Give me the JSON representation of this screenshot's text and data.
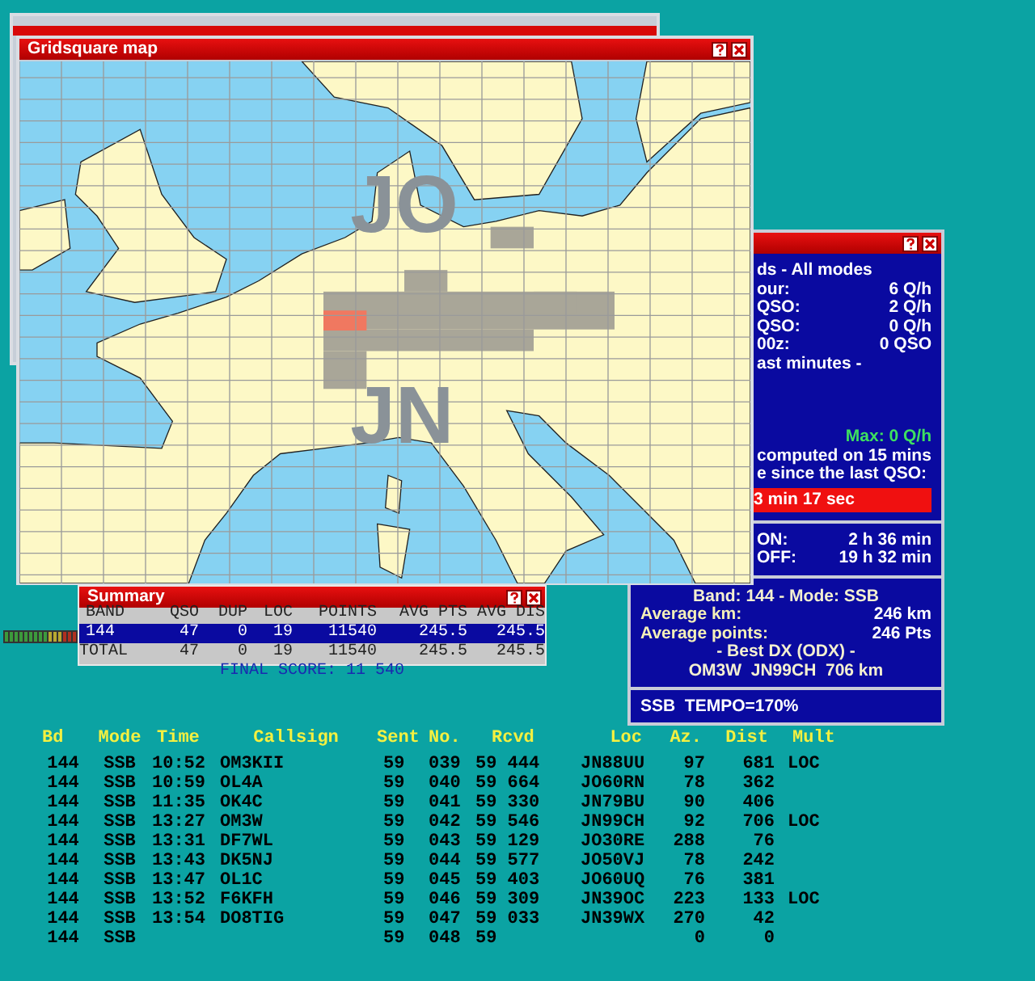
{
  "map_window": {
    "title": "Gridsquare map",
    "grid_labels": [
      "JO",
      "JN"
    ]
  },
  "rate_window": {
    "sections": [
      {
        "rows": [
          {
            "kind": "text",
            "text": "ds - All modes"
          },
          {
            "kind": "pair",
            "label": "our:",
            "value": "6 Q/h"
          },
          {
            "kind": "pair",
            "label": "QSO:",
            "value": "2 Q/h"
          },
          {
            "kind": "pair",
            "label": "QSO:",
            "value": "0 Q/h"
          },
          {
            "kind": "pair",
            "label": "00z:",
            "value": "0 QSO"
          },
          {
            "kind": "text",
            "text": "ast minutes -"
          },
          {
            "kind": "highlight",
            "text": "Max: 0 Q/h"
          },
          {
            "kind": "text",
            "text": "computed on 15 mins"
          },
          {
            "kind": "text",
            "text": "e since the last QSO:"
          },
          {
            "kind": "alert",
            "text": "3 min 17 sec"
          }
        ]
      },
      {
        "rows": [
          {
            "kind": "pair",
            "label": "ON:",
            "value": "2 h 36 min"
          },
          {
            "kind": "pair",
            "label": "OFF:",
            "value": "19 h 32 min"
          }
        ]
      },
      {
        "rows": [
          {
            "kind": "center",
            "text": "Band: 144 - Mode: SSB"
          },
          {
            "kind": "pair",
            "label": "Average km:",
            "value": "246 km"
          },
          {
            "kind": "pair",
            "label": "Average points:",
            "value": "246 Pts"
          },
          {
            "kind": "center",
            "text": "- Best DX (ODX) -"
          },
          {
            "kind": "center",
            "text": "OM3W  JN99CH  706 km"
          }
        ]
      },
      {
        "rows": [
          {
            "kind": "text",
            "text": "SSB  TEMPO=170%"
          }
        ]
      }
    ]
  },
  "summary": {
    "title": "Summary",
    "columns": [
      "BAND",
      "QSO",
      "DUP",
      "LOC",
      "POINTS",
      "AVG PTS",
      "AVG DIS"
    ],
    "rows": [
      {
        "cells": [
          "144",
          "47",
          "0",
          "19",
          "11540",
          "245.5",
          "245.5"
        ],
        "selected": true
      },
      {
        "cells": [
          "TOTAL",
          "47",
          "0",
          "19",
          "11540",
          "245.5",
          "245.5"
        ],
        "selected": false
      }
    ],
    "final_score": "FINAL SCORE: 11 540"
  },
  "log": {
    "columns": [
      "Bd",
      "Mode",
      "Time",
      "Callsign",
      "Sent",
      "No.",
      "Rcvd",
      "Loc",
      "Az.",
      "Dist",
      "Mult"
    ],
    "rows": [
      {
        "bd": "144",
        "mode": "SSB",
        "time": "10:52",
        "callsign": "OM3KII",
        "sent": "59",
        "no": "039",
        "rcvd": "59 444",
        "loc": "JN88UU",
        "az": "97",
        "dist": "681",
        "mult": "LOC"
      },
      {
        "bd": "144",
        "mode": "SSB",
        "time": "10:59",
        "callsign": "OL4A",
        "sent": "59",
        "no": "040",
        "rcvd": "59 664",
        "loc": "JO60RN",
        "az": "78",
        "dist": "362"
      },
      {
        "bd": "144",
        "mode": "SSB",
        "time": "11:35",
        "callsign": "OK4C",
        "sent": "59",
        "no": "041",
        "rcvd": "59 330",
        "loc": "JN79BU",
        "az": "90",
        "dist": "406"
      },
      {
        "bd": "144",
        "mode": "SSB",
        "time": "13:27",
        "callsign": "OM3W",
        "sent": "59",
        "no": "042",
        "rcvd": "59 546",
        "loc": "JN99CH",
        "az": "92",
        "dist": "706",
        "mult": "LOC"
      },
      {
        "bd": "144",
        "mode": "SSB",
        "time": "13:31",
        "callsign": "DF7WL",
        "sent": "59",
        "no": "043",
        "rcvd": "59 129",
        "loc": "JO30RE",
        "az": "288",
        "dist": "76"
      },
      {
        "bd": "144",
        "mode": "SSB",
        "time": "13:43",
        "callsign": "DK5NJ",
        "sent": "59",
        "no": "044",
        "rcvd": "59 577",
        "loc": "JO50VJ",
        "az": "78",
        "dist": "242"
      },
      {
        "bd": "144",
        "mode": "SSB",
        "time": "13:47",
        "callsign": "OL1C",
        "sent": "59",
        "no": "045",
        "rcvd": "59 403",
        "loc": "JO60UQ",
        "az": "76",
        "dist": "381"
      },
      {
        "bd": "144",
        "mode": "SSB",
        "time": "13:52",
        "callsign": "F6KFH",
        "sent": "59",
        "no": "046",
        "rcvd": "59 309",
        "loc": "JN39OC",
        "az": "223",
        "dist": "133",
        "mult": "LOC"
      },
      {
        "bd": "144",
        "mode": "SSB",
        "time": "13:54",
        "callsign": "DO8TIG",
        "sent": "59",
        "no": "047",
        "rcvd": "59 033",
        "loc": "JN39WX",
        "az": "270",
        "dist": "42"
      },
      {
        "bd": "144",
        "mode": "SSB",
        "sent": "59",
        "no": "048",
        "rcvd": "59",
        "az": "0",
        "dist": "0"
      }
    ]
  }
}
